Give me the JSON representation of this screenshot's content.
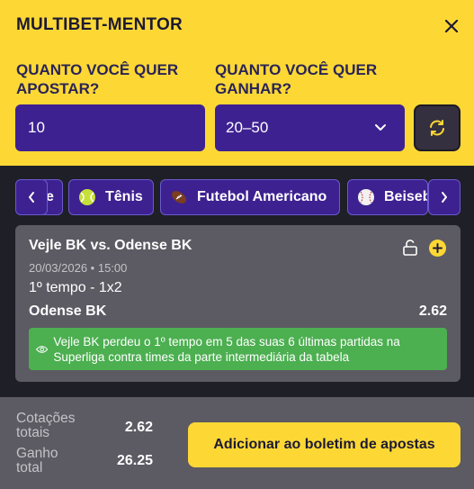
{
  "header": {
    "title": "MULTIBET-MENTOR",
    "bet_label": "QUANTO VOCÊ QUER APOSTAR?",
    "win_label": "QUANTO VOCÊ QUER GANHAR?",
    "bet_value": "10",
    "win_value": "20–50"
  },
  "sports": {
    "items": [
      {
        "label": "e",
        "icon": "partial-chip"
      },
      {
        "label": "Tênis",
        "icon": "tennis-ball-icon"
      },
      {
        "label": "Futebol Americano",
        "icon": "american-football-icon"
      },
      {
        "label": "Beisebol",
        "icon": "baseball-icon"
      }
    ]
  },
  "card": {
    "match": "Vejle BK vs. Odense BK",
    "datetime": "20/03/2026 • 15:00",
    "market": "1º tempo - 1x2",
    "selection": "Odense BK",
    "odds": "2.62",
    "hint": "Vejle BK perdeu o 1º tempo em 5 das suas 6 últimas partidas na Superliga contra times da parte intermediária da tabela"
  },
  "footer": {
    "total_odds_label": "Cotações totais",
    "total_odds": "2.62",
    "total_win_label": "Ganho total",
    "total_win": "26.25",
    "cta_label": "Adicionar ao boletim de apostas"
  },
  "colors": {
    "accent_yellow": "#fdd835",
    "brand_purple": "#3d2191",
    "card_gray": "#5c5a62",
    "hint_green": "#4caf50"
  }
}
